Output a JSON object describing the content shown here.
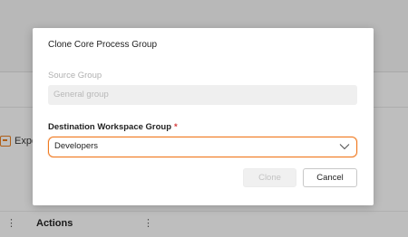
{
  "background": {
    "export_label": "Expo",
    "actions_label": "Actions",
    "kebab_glyph": "⋮"
  },
  "modal": {
    "title": "Clone Core Process Group",
    "source_group": {
      "label": "Source Group",
      "value": "General group"
    },
    "destination_group": {
      "label": "Destination Workspace Group",
      "required_mark": "*",
      "selected_value": "Developers"
    },
    "buttons": {
      "clone_label": "Clone",
      "cancel_label": "Cancel"
    }
  },
  "colors": {
    "accent": "#f07a20",
    "required": "#d63b3b"
  }
}
